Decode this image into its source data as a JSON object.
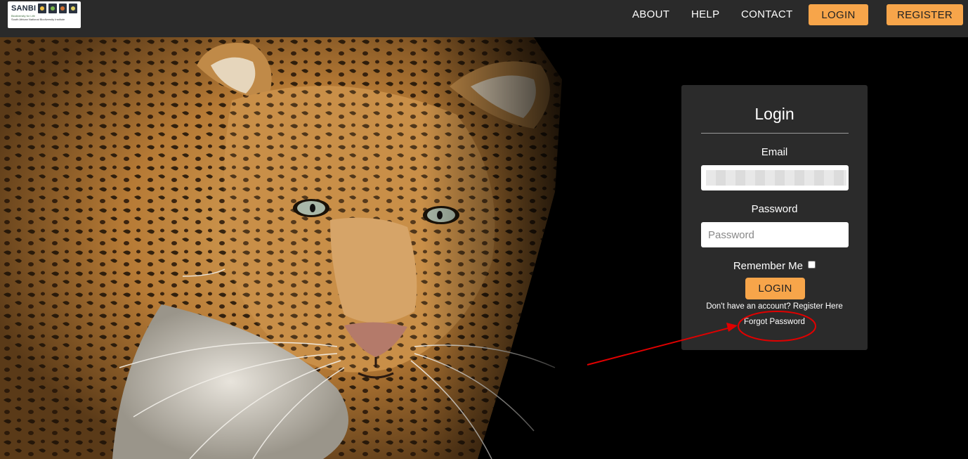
{
  "header": {
    "logo": {
      "brand": "SANBI",
      "tagline": "Biodiversity for Life",
      "full_name": "South African National Biodiversity Institute"
    },
    "nav": {
      "about": "ABOUT",
      "help": "HELP",
      "contact": "CONTACT",
      "login": "LOGIN",
      "register": "REGISTER"
    }
  },
  "hero": {
    "image": "leopard-photo"
  },
  "login_form": {
    "title": "Login",
    "email_label": "Email",
    "email_value": "",
    "password_label": "Password",
    "password_placeholder": "Password",
    "remember_label": "Remember Me",
    "remember_checked": false,
    "submit_label": "LOGIN",
    "register_text": "Don't have an account? Register Here",
    "forgot_text": "Forgot Password"
  },
  "colors": {
    "accent": "#f7a54a",
    "header_bg": "#2a2a2a",
    "card_bg": "#2b2b2b",
    "annotation": "#e00000"
  }
}
